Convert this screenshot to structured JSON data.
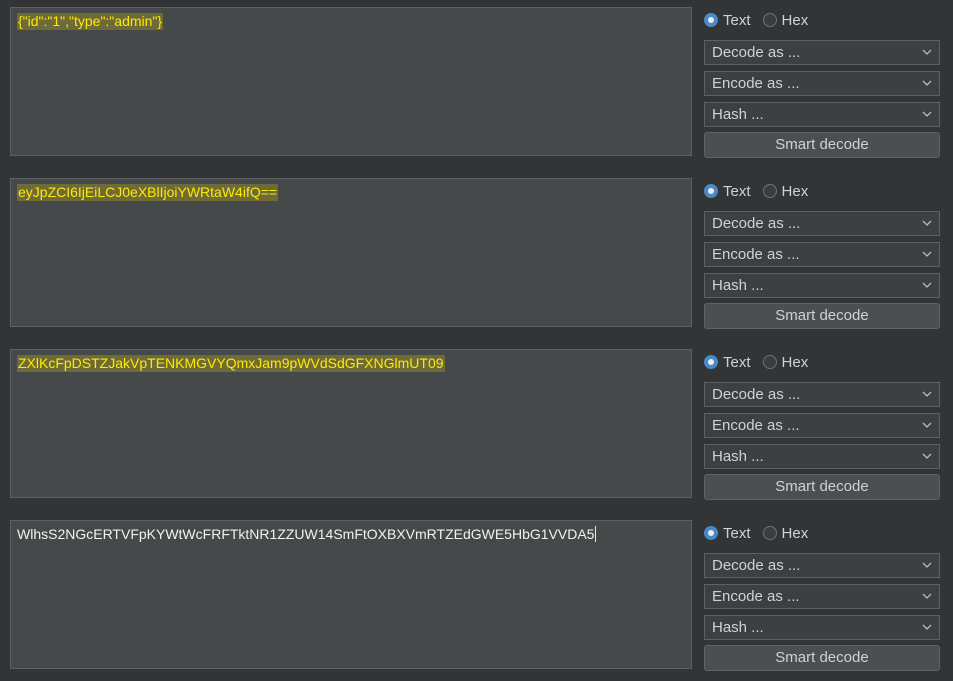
{
  "panels": [
    {
      "content": "{\"id\":\"1\",\"type\":\"admin\"}",
      "highlighted": true,
      "radio_text": "Text",
      "radio_hex": "Hex",
      "decode_label": "Decode as ...",
      "encode_label": "Encode as ...",
      "hash_label": "Hash ...",
      "smart_label": "Smart decode"
    },
    {
      "content": "eyJpZCI6IjEiLCJ0eXBlIjoiYWRtaW4ifQ==",
      "highlighted": true,
      "radio_text": "Text",
      "radio_hex": "Hex",
      "decode_label": "Decode as ...",
      "encode_label": "Encode as ...",
      "hash_label": "Hash ...",
      "smart_label": "Smart decode"
    },
    {
      "content": "ZXlKcFpDSTZJakVpTENKMGVYQmxJam9pWVdSdGFXNGlmUT09",
      "highlighted": true,
      "radio_text": "Text",
      "radio_hex": "Hex",
      "decode_label": "Decode as ...",
      "encode_label": "Encode as ...",
      "hash_label": "Hash ...",
      "smart_label": "Smart decode"
    },
    {
      "content": "WlhsS2NGcERTVFpKYWtWcFRFTktNR1ZZUW14SmFtOXBXVmRTZEdGWE5HbG1VVDA5",
      "highlighted": false,
      "radio_text": "Text",
      "radio_hex": "Hex",
      "decode_label": "Decode as ...",
      "encode_label": "Encode as ...",
      "hash_label": "Hash ...",
      "smart_label": "Smart decode"
    }
  ],
  "colors": {
    "background": "#323436",
    "text_area": "#45494a",
    "highlight_text": "#ffeb00",
    "radio_selected": "#4a88c7"
  },
  "icons": {
    "dropdown": "chevron-down-icon",
    "radio": "radio-button"
  }
}
